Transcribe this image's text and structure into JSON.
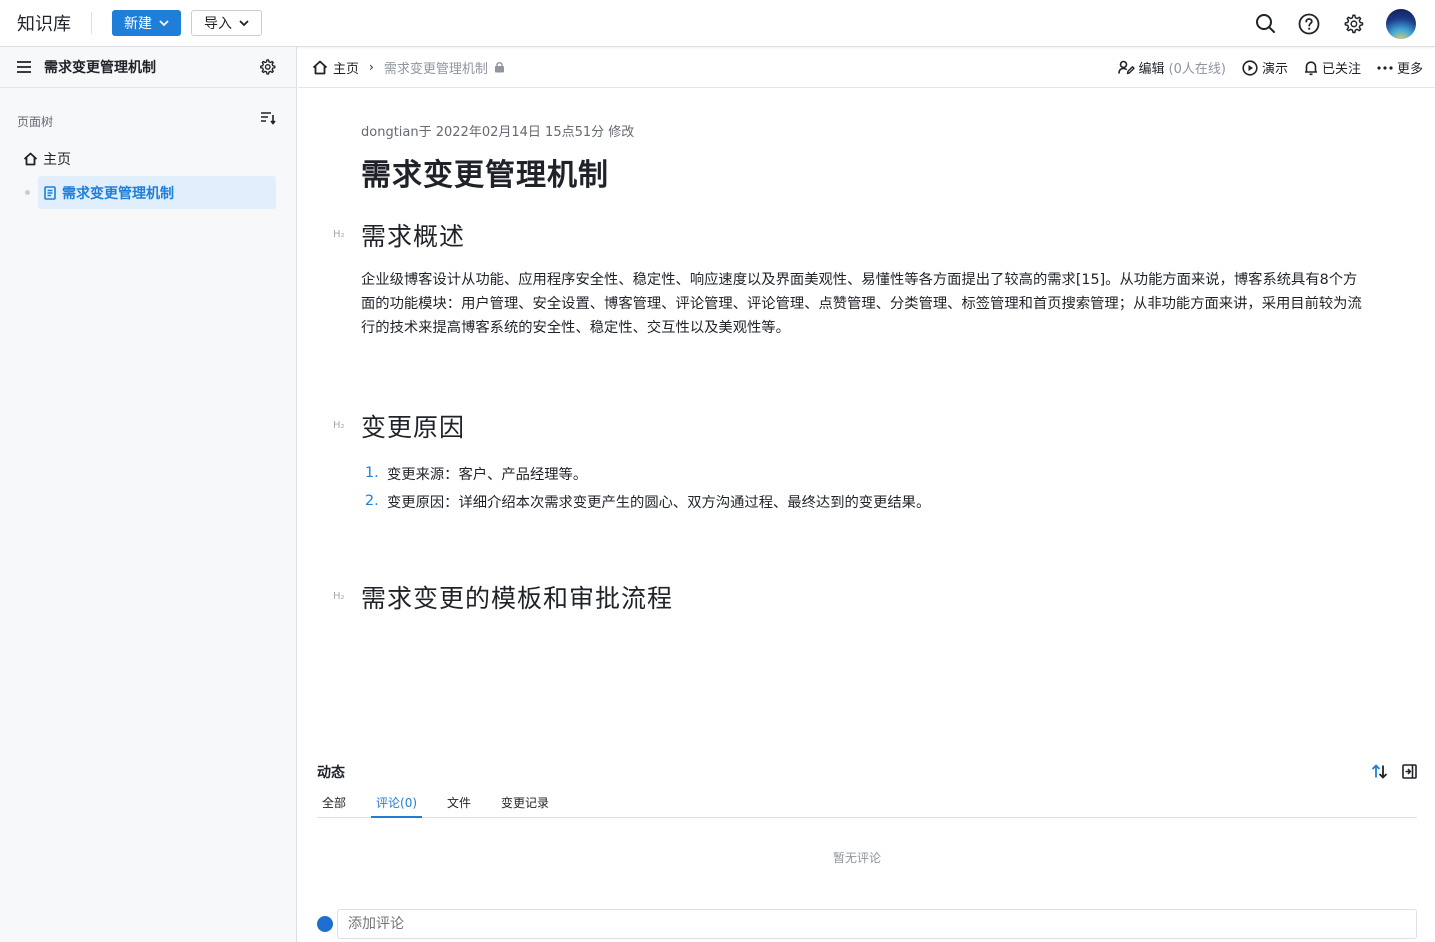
{
  "app": {
    "title": "知识库",
    "new_label": "新建",
    "import_label": "导入",
    "icons": [
      "search-icon",
      "help-icon",
      "gear-icon",
      "avatar"
    ]
  },
  "sidebar": {
    "space_name": "需求变更管理机制",
    "tree_label": "页面树",
    "tree": {
      "home": "主页",
      "items": [
        {
          "label": "需求变更管理机制",
          "selected": true
        }
      ]
    }
  },
  "header": {
    "breadcrumb": {
      "home": "主页",
      "separator": "›",
      "current": "需求变更管理机制"
    },
    "actions": {
      "edit": "编辑",
      "online": "(0人在线)",
      "present": "演示",
      "following": "已关注",
      "more": "更多"
    }
  },
  "doc": {
    "meta": "dongtian于 2022年02月14日 15点51分 修改",
    "title": "需求变更管理机制",
    "h2_marker": "H₂",
    "sections": [
      {
        "heading": "需求概述",
        "paragraph": "企业级博客设计从功能、应用程序安全性、稳定性、响应速度以及界面美观性、易懂性等各方面提出了较高的需求[15]。从功能方面来说，博客系统具有8个方面的功能模块：用户管理、安全设置、博客管理、评论管理、评论管理、点赞管理、分类管理、标签管理和首页搜索管理；从非功能方面来讲，采用目前较为流行的技术来提高博客系统的安全性、稳定性、交互性以及美观性等。"
      },
      {
        "heading": "变更原因",
        "list": [
          {
            "num": "1.",
            "text": "变更来源：客户、产品经理等。"
          },
          {
            "num": "2.",
            "text": "变更原因：详细介绍本次需求变更产生的圆心、双方沟通过程、最终达到的变更结果。"
          }
        ]
      },
      {
        "heading": "需求变更的模板和审批流程"
      }
    ]
  },
  "activity": {
    "title": "动态",
    "tabs": [
      {
        "label": "全部",
        "active": false
      },
      {
        "label": "评论(0)",
        "active": true
      },
      {
        "label": "文件",
        "active": false
      },
      {
        "label": "变更记录",
        "active": false
      }
    ],
    "empty_text": "暂无评论",
    "comment_placeholder": "添加评论"
  },
  "colors": {
    "accent": "#1f7fd8",
    "selected_bg": "#e1eefb",
    "sidebar_bg": "#f7f8fa"
  }
}
